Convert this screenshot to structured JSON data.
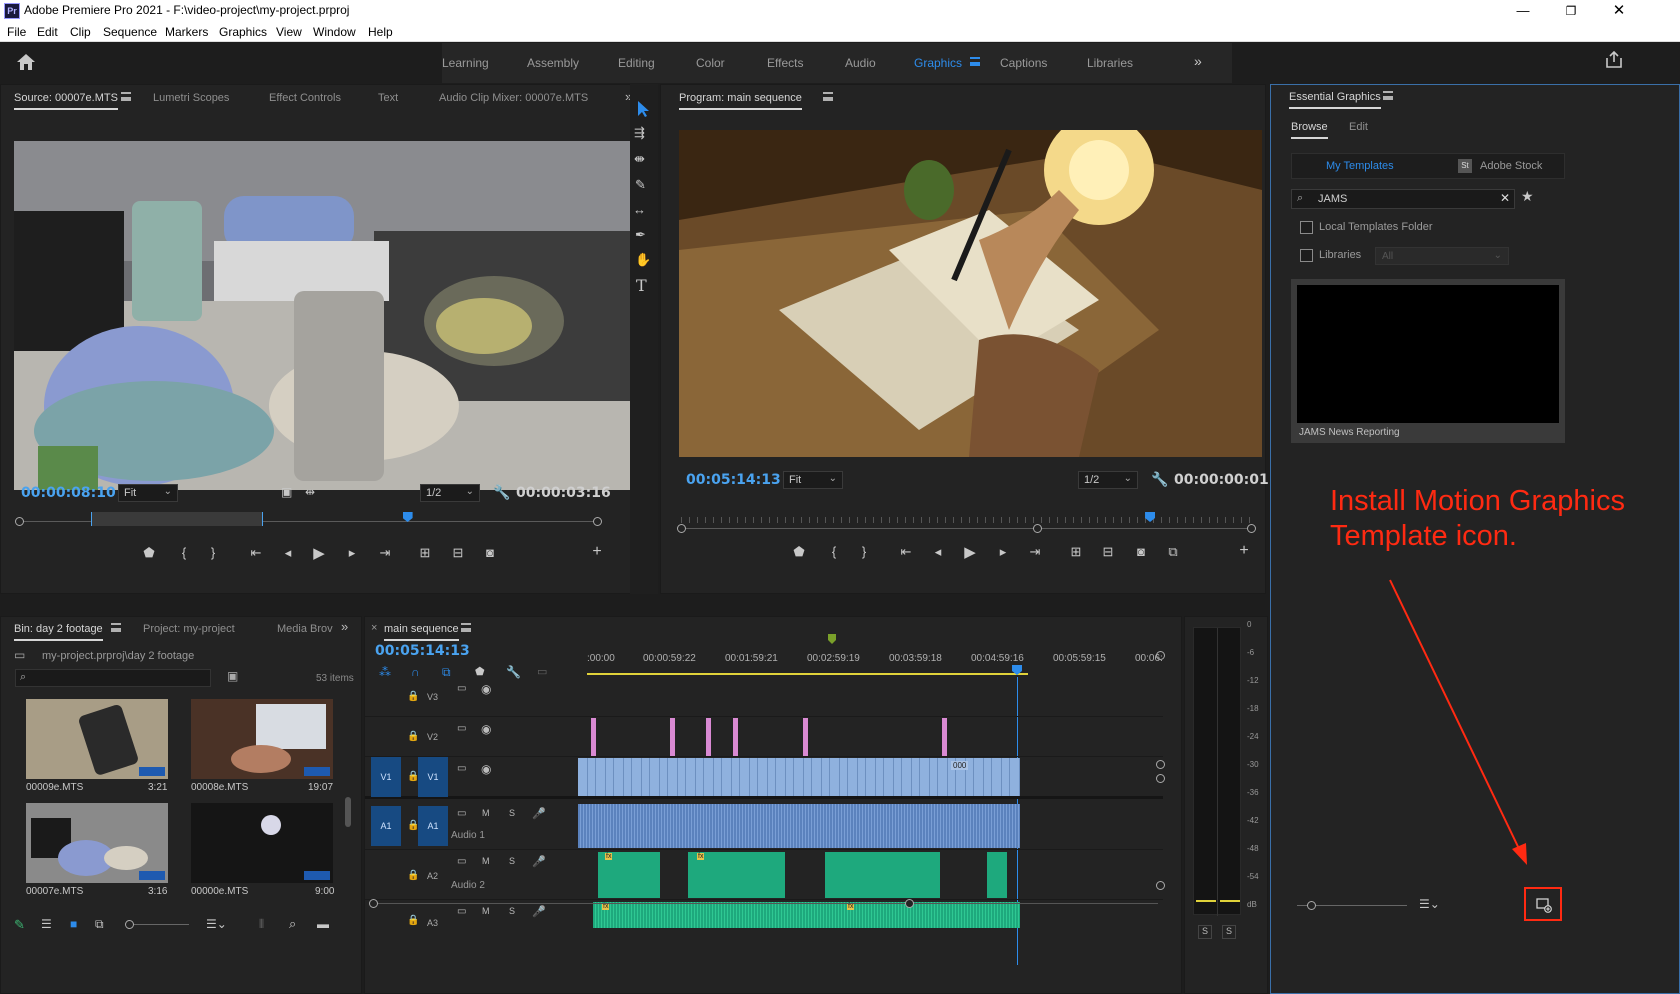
{
  "window": {
    "app_icon": "Pr",
    "title": "Adobe Premiere Pro 2021 - F:\\video-project\\my-project.prproj"
  },
  "menu": [
    "File",
    "Edit",
    "Clip",
    "Sequence",
    "Markers",
    "Graphics",
    "View",
    "Window",
    "Help"
  ],
  "workspaces": {
    "tabs": [
      "Learning",
      "Assembly",
      "Editing",
      "Color",
      "Effects",
      "Audio",
      "Graphics",
      "Captions",
      "Libraries"
    ],
    "active": "Graphics",
    "overflow_icon": "chevron-double-right-icon",
    "home_icon": "home-icon",
    "share_icon": "share-icon"
  },
  "source_panel": {
    "tabs": [
      "Source: 00007e.MTS",
      "Lumetri Scopes",
      "Effect Controls",
      "Text",
      "Audio Clip Mixer: 00007e.MTS"
    ],
    "timecode": "00:00:08:10",
    "fit": "Fit",
    "resolution": "1/2",
    "duration": "00:00:03:16",
    "playhead_fraction": 0.67
  },
  "tools": [
    "selection-tool-icon",
    "track-select-tool-icon",
    "ripple-edit-tool-icon",
    "razor-tool-icon",
    "slip-tool-icon",
    "pen-tool-icon",
    "hand-tool-icon",
    "type-tool-icon"
  ],
  "program_panel": {
    "title": "Program: main sequence",
    "timecode": "00:05:14:13",
    "fit": "Fit",
    "resolution": "1/2",
    "duration": "00:00:00:01",
    "playhead_fraction": 0.82
  },
  "project_panel": {
    "tabs": [
      "Bin: day 2 footage",
      "Project: my-project",
      "Media Brov"
    ],
    "path": "my-project.prproj\\day 2 footage",
    "items_count": "53 items",
    "items": [
      {
        "name": "00009e.MTS",
        "duration": "3:21"
      },
      {
        "name": "00008e.MTS",
        "duration": "19:07"
      },
      {
        "name": "00007e.MTS",
        "duration": "3:16"
      },
      {
        "name": "00000e.MTS",
        "duration": "9:00"
      }
    ]
  },
  "timeline": {
    "tab": "main sequence",
    "timecode": "00:05:14:13",
    "ruler": [
      ":00:00",
      "00:00:59:22",
      "00:01:59:21",
      "00:02:59:19",
      "00:03:59:18",
      "00:04:59:16",
      "00:05:59:15",
      "00:06:"
    ],
    "tracks": {
      "v3": "V3",
      "v2": "V2",
      "v1": "V1",
      "v1_src": "V1",
      "a1": "A1",
      "a1_src": "A1",
      "a2": "A2",
      "a3": "A3",
      "audio1_name": "Audio 1",
      "audio2_name": "Audio 2"
    },
    "track_buttons": {
      "mute": "M",
      "solo": "S"
    },
    "clip_badge": "000",
    "fx_label": "fx"
  },
  "audio_meter": {
    "scale": [
      "0",
      "-6",
      "-12",
      "-18",
      "-24",
      "-30",
      "-36",
      "-42",
      "-48",
      "-54",
      "dB"
    ],
    "solo_labels": [
      "S",
      "S"
    ]
  },
  "essential_graphics": {
    "title": "Essential Graphics",
    "subtabs": [
      "Browse",
      "Edit"
    ],
    "source_tabs": [
      "My Templates",
      "Adobe Stock"
    ],
    "stock_badge": "St",
    "search_value": "JAMS",
    "checkbox_local": "Local Templates Folder",
    "checkbox_libraries": "Libraries",
    "libraries_select": "All",
    "template_name": "JAMS News Reporting"
  },
  "annotation": {
    "text": "Install Motion Graphics Template icon.",
    "color": "#ff2a12"
  },
  "colors": {
    "accent_blue": "#2d8ceb",
    "video_clip": "#8fb1de",
    "audio_clip_blue": "#5b82bd",
    "audio_clip_green": "#1ea97d",
    "graphics_clip": "#d98ad3",
    "track_target": "#174a82"
  }
}
